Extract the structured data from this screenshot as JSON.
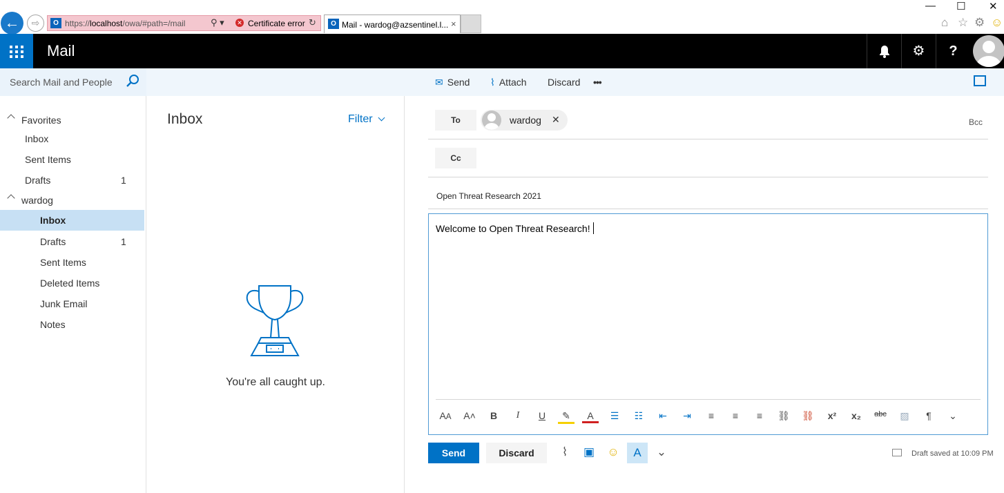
{
  "browser": {
    "url_prefix": "https://",
    "url_host": "localhost",
    "url_path": "/owa/#path=/mail",
    "cert_error": "Certificate error",
    "tab_title": "Mail - wardog@azsentinel.l...",
    "tab_close": "×",
    "back_glyph": "←",
    "forward_glyph": "⇨"
  },
  "window": {
    "minimize": "—",
    "maximize": "☐",
    "close": "✕"
  },
  "owa": {
    "app_title": "Mail",
    "help": "?"
  },
  "search": {
    "placeholder": "Search Mail and People"
  },
  "commands": {
    "send": "Send",
    "attach": "Attach",
    "discard": "Discard",
    "more": "•••"
  },
  "folders": {
    "favorites_label": "Favorites",
    "favorites": [
      {
        "label": "Inbox",
        "count": ""
      },
      {
        "label": "Sent Items",
        "count": ""
      },
      {
        "label": "Drafts",
        "count": "1"
      }
    ],
    "account_label": "wardog",
    "account": [
      {
        "label": "Inbox",
        "count": "",
        "selected": true
      },
      {
        "label": "Drafts",
        "count": "1"
      },
      {
        "label": "Sent Items",
        "count": ""
      },
      {
        "label": "Deleted Items",
        "count": ""
      },
      {
        "label": "Junk Email",
        "count": ""
      },
      {
        "label": "Notes",
        "count": ""
      }
    ]
  },
  "list": {
    "title": "Inbox",
    "filter": "Filter",
    "empty_text": "You're all caught up."
  },
  "compose": {
    "to_label": "To",
    "cc_label": "Cc",
    "bcc_label": "Bcc",
    "recipient": "wardog",
    "remove": "✕",
    "subject": "Open Threat Research 2021",
    "body": "Welcome to Open Threat Research!",
    "send": "Send",
    "discard": "Discard",
    "draft_status": "Draft saved at 10:09 PM"
  },
  "colors": {
    "accent": "#0072c6",
    "selected": "#c7e0f4",
    "command_bar": "#eff6fc"
  }
}
